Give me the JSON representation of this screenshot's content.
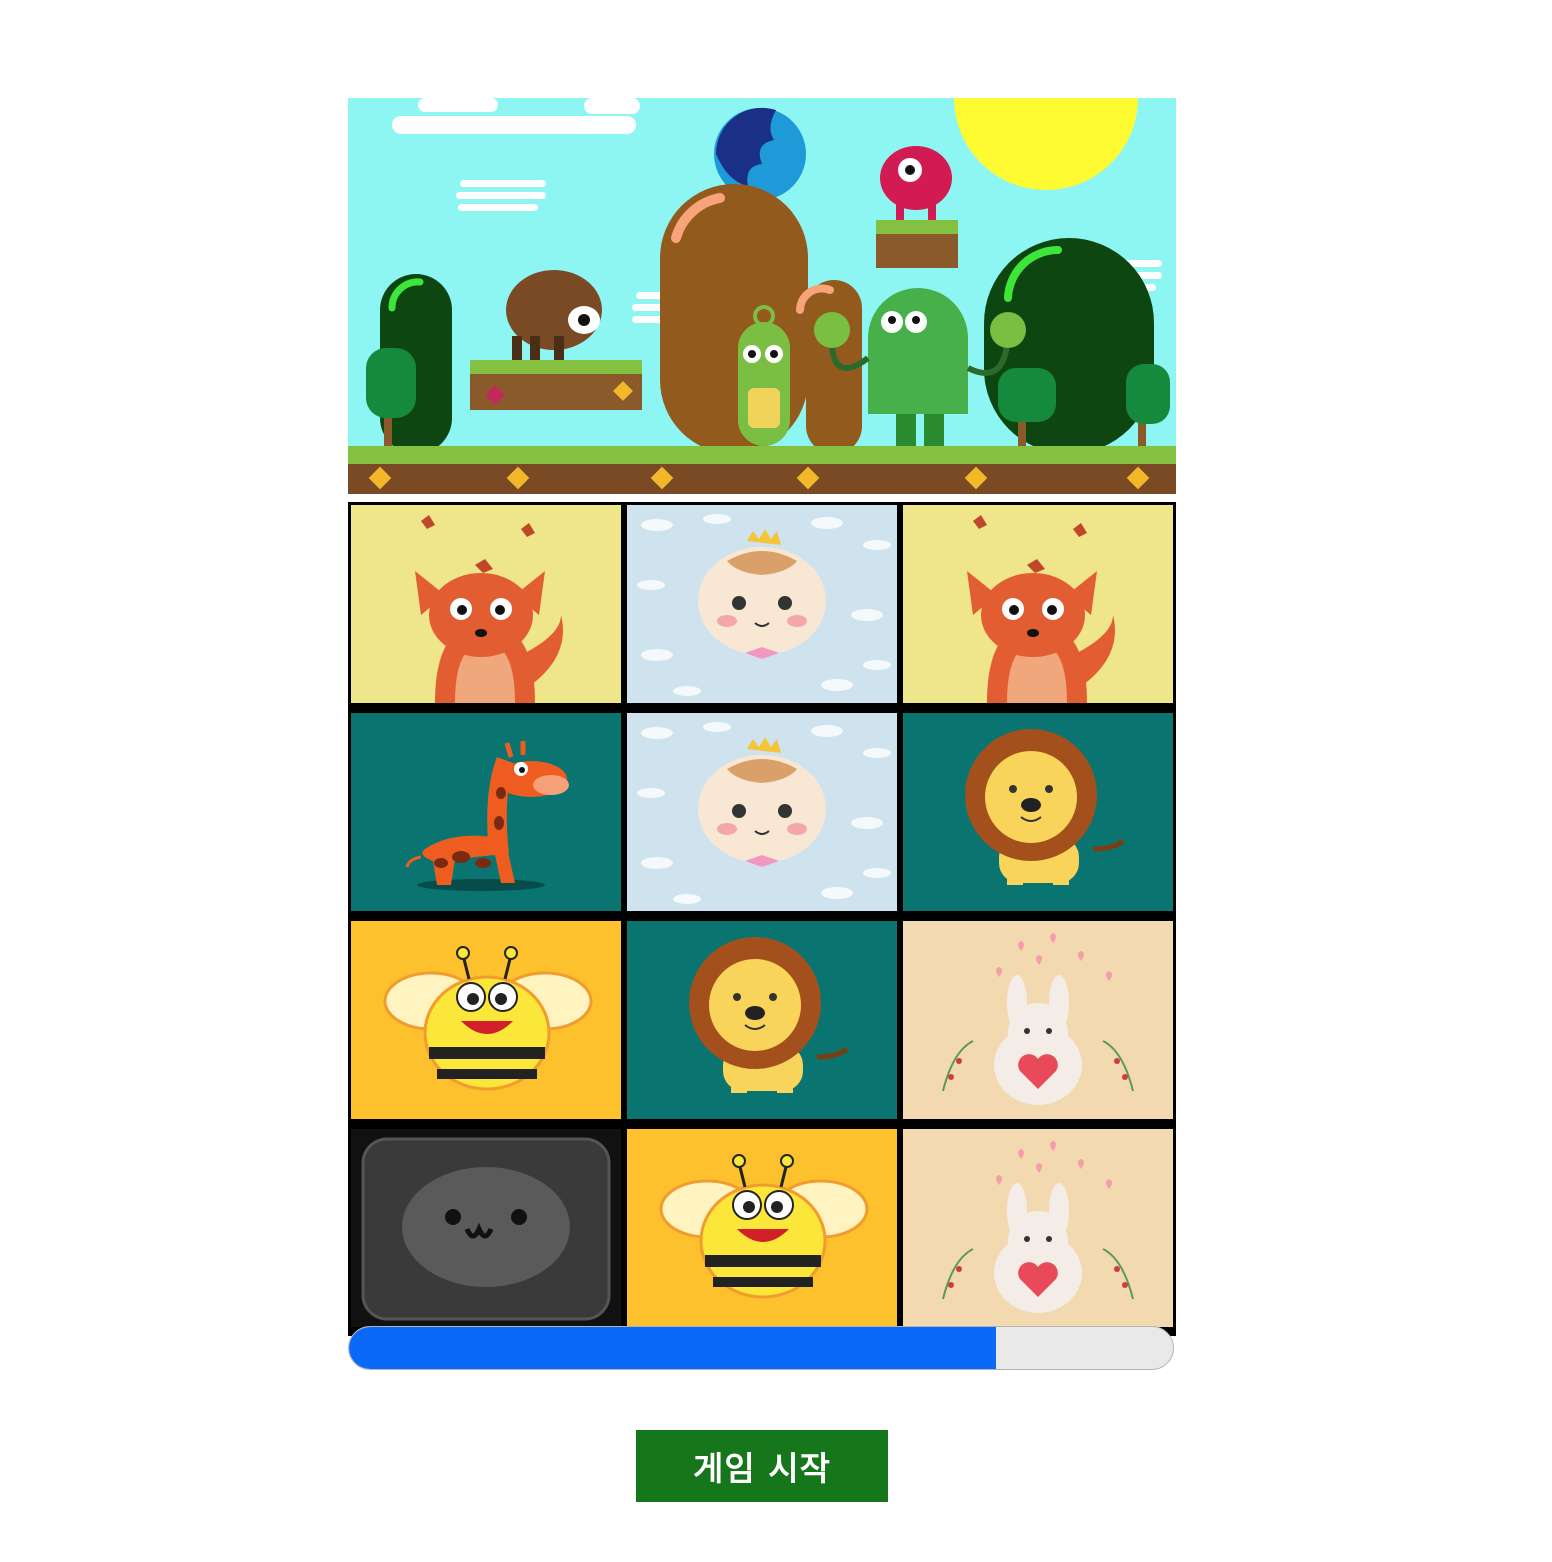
{
  "banner": {
    "icon": "platformer-monsters-scene"
  },
  "grid": {
    "cards": [
      {
        "icon": "fox-card",
        "state": "face-up"
      },
      {
        "icon": "princess-cat-card",
        "state": "face-up"
      },
      {
        "icon": "fox-card",
        "state": "face-up"
      },
      {
        "icon": "giraffe-card",
        "state": "face-up"
      },
      {
        "icon": "princess-cat-card",
        "state": "face-up"
      },
      {
        "icon": "lion-card",
        "state": "face-up"
      },
      {
        "icon": "bee-card",
        "state": "face-up"
      },
      {
        "icon": "lion-card",
        "state": "face-up"
      },
      {
        "icon": "bunny-heart-card",
        "state": "face-up"
      },
      {
        "icon": "face-down-card-back",
        "state": "face-down"
      },
      {
        "icon": "bee-card",
        "state": "face-up"
      },
      {
        "icon": "bunny-heart-card",
        "state": "face-up"
      }
    ]
  },
  "progress": {
    "value": 0.785,
    "fill_color": "#0a69f6"
  },
  "start_button": {
    "label": "게임 시작",
    "color": "#16761b"
  }
}
